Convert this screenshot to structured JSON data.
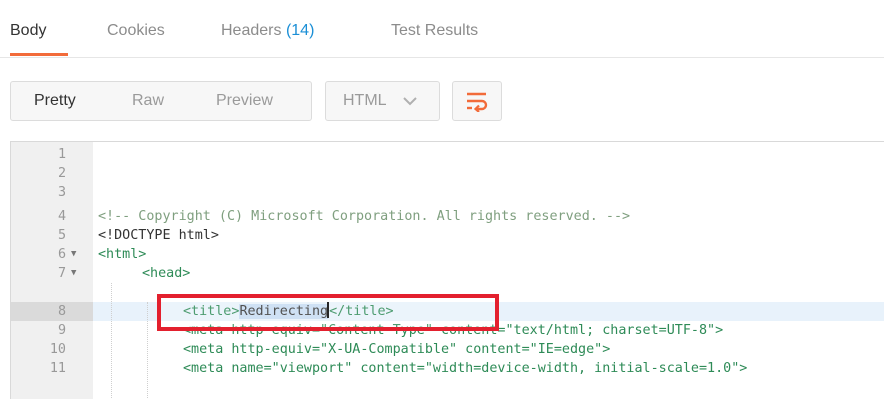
{
  "tabs": {
    "body": "Body",
    "cookies": "Cookies",
    "headers": "Headers",
    "headers_count": "(14)",
    "test_results": "Test Results"
  },
  "toolbar": {
    "pretty": "Pretty",
    "raw": "Raw",
    "preview": "Preview",
    "language": "HTML",
    "wrap_icon": "wrap-lines-icon"
  },
  "editor": {
    "line_numbers": [
      "1",
      "2",
      "3",
      "4",
      "5",
      "6",
      "7",
      "8",
      "9",
      "10",
      "11"
    ],
    "line4": "<!-- Copyright (C) Microsoft Corporation. All rights reserved. -->",
    "line5": "<!DOCTYPE html>",
    "line6": "<html>",
    "line7": "<head>",
    "line8_open": "<title>",
    "line8_text": "Redirecting",
    "line8_close": "</title>",
    "line9": "<meta http-equiv=\"Content-Type\" content=\"text/html; charset=UTF-8\">",
    "line10": "<meta http-equiv=\"X-UA-Compatible\" content=\"IE=edge\">",
    "line11": "<meta name=\"viewport\" content=\"width=device-width, initial-scale=1.0\">"
  },
  "colors": {
    "accent": "#f26b3a",
    "count": "#1b8fd6",
    "highlight_box": "#e3202e"
  }
}
